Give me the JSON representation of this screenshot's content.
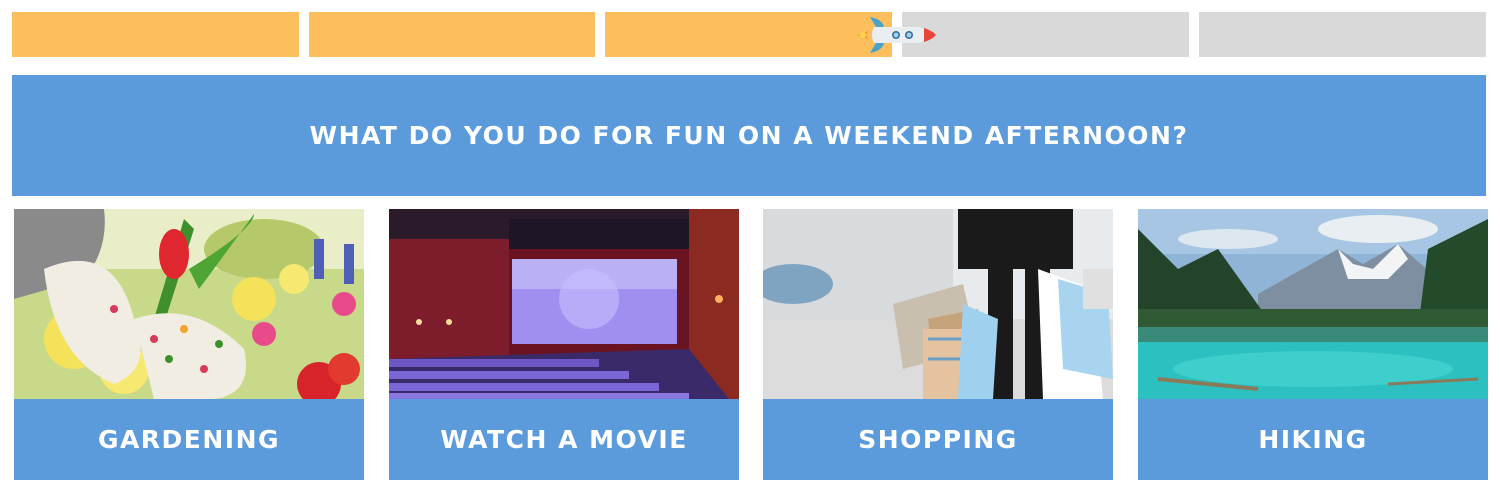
{
  "progress": {
    "segments_total": 5,
    "filled_fraction": 0.6,
    "fill_color": "#fdbf5e",
    "empty_color": "#d9d9d9",
    "indicator_icon": "rocket-icon"
  },
  "question": {
    "text": "What do you do for fun on a weekend afternoon?",
    "bg_color": "#5b9bdc"
  },
  "options": [
    {
      "label": "Gardening",
      "image": "gardening-flowers-photo"
    },
    {
      "label": "Watch a movie",
      "image": "cinema-screen-photo"
    },
    {
      "label": "Shopping",
      "image": "shopping-bags-photo"
    },
    {
      "label": "Hiking",
      "image": "mountain-lake-photo"
    }
  ]
}
